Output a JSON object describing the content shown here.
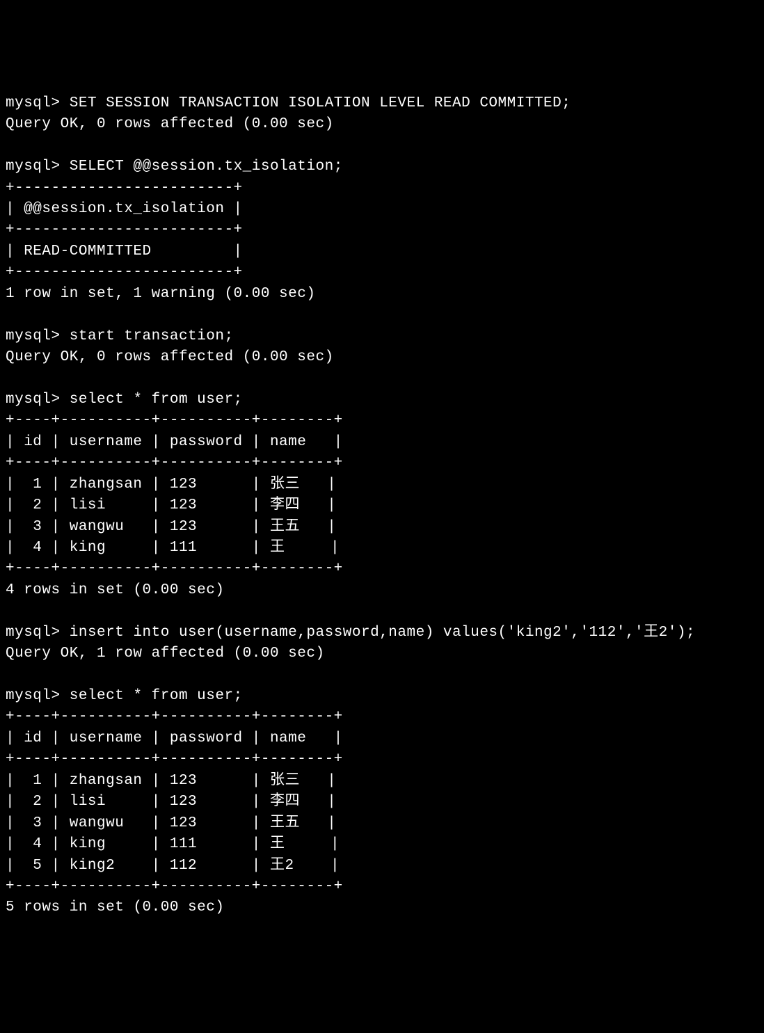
{
  "terminal": {
    "prompt": "mysql>",
    "commands": {
      "set_isolation": "SET SESSION TRANSACTION ISOLATION LEVEL READ COMMITTED;",
      "set_isolation_result": "Query OK, 0 rows affected (0.00 sec)",
      "select_isolation": "SELECT @@session.tx_isolation;",
      "isolation_border": "+------------------------+",
      "isolation_header": "| @@session.tx_isolation |",
      "isolation_value": "| READ-COMMITTED         |",
      "isolation_summary": "1 row in set, 1 warning (0.00 sec)",
      "start_transaction": "start transaction;",
      "start_transaction_result": "Query OK, 0 rows affected (0.00 sec)",
      "select_user1": "select * from user;",
      "table_border": "+----+----------+----------+--------+",
      "table_header": "| id | username | password | name   |",
      "table1_row1": "|  1 | zhangsan | 123      | 张三   |",
      "table1_row2": "|  2 | lisi     | 123      | 李四   |",
      "table1_row3": "|  3 | wangwu   | 123      | 王五   |",
      "table1_row4": "|  4 | king     | 111      | 王     |",
      "table1_summary": "4 rows in set (0.00 sec)",
      "insert_user": "insert into user(username,password,name) values('king2','112','王2');",
      "insert_result": "Query OK, 1 row affected (0.00 sec)",
      "select_user2": "select * from user;",
      "table2_row1": "|  1 | zhangsan | 123      | 张三   |",
      "table2_row2": "|  2 | lisi     | 123      | 李四   |",
      "table2_row3": "|  3 | wangwu   | 123      | 王五   |",
      "table2_row4": "|  4 | king     | 111      | 王     |",
      "table2_row5": "|  5 | king2    | 112      | 王2    |",
      "table2_summary": "5 rows in set (0.00 sec)"
    }
  }
}
